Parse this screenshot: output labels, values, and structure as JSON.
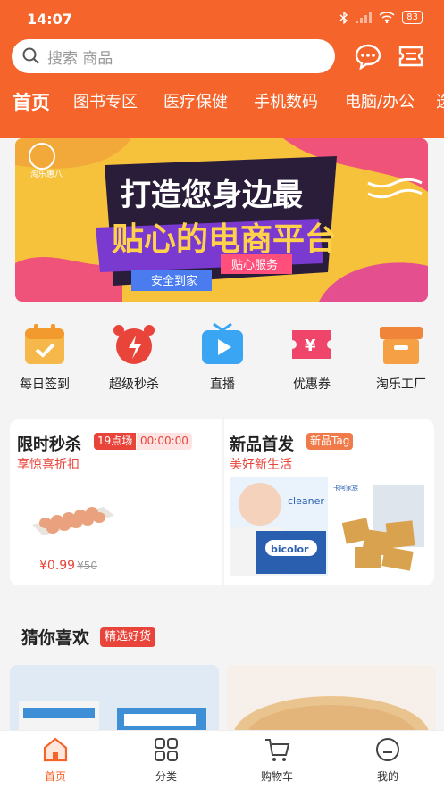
{
  "status": {
    "time": "14:07",
    "battery": "83"
  },
  "search": {
    "placeholder": "搜索 商品"
  },
  "tabs": [
    {
      "label": "首页"
    },
    {
      "label": "图书专区"
    },
    {
      "label": "医疗保健"
    },
    {
      "label": "手机数码"
    },
    {
      "label": "电脑/办公"
    },
    {
      "label": "选"
    }
  ],
  "banner": {
    "logo_text": "淘乐惠八",
    "headline1": "打造您身边最",
    "headline2": "贴心的电商平台",
    "tag1": "安全到家",
    "tag2": "贴心服务"
  },
  "categories": [
    {
      "label": "每日签到",
      "icon": "calendar-check-icon"
    },
    {
      "label": "超级秒杀",
      "icon": "alarm-clock-icon"
    },
    {
      "label": "直播",
      "icon": "tv-play-icon"
    },
    {
      "label": "优惠券",
      "icon": "coupon-icon"
    },
    {
      "label": "淘乐工厂",
      "icon": "box-icon"
    }
  ],
  "flash": {
    "title": "限时秒杀",
    "session": "19点场",
    "countdown": "00:00:00",
    "subtitle": "享惊喜折扣",
    "price": "¥0.99",
    "old_price": "¥50"
  },
  "newarrival": {
    "title": "新品首发",
    "tag": "新品Tag",
    "subtitle": "美好新生活",
    "brand1": "cleaner",
    "brand2": "bicolor",
    "brand3": "卡阿家族"
  },
  "guess": {
    "title": "猜你喜欢",
    "badge": "精选好货"
  },
  "nav": [
    {
      "label": "首页",
      "icon": "home-icon"
    },
    {
      "label": "分类",
      "icon": "category-grid-icon"
    },
    {
      "label": "购物车",
      "icon": "cart-icon"
    },
    {
      "label": "我的",
      "icon": "profile-icon"
    }
  ],
  "colors": {
    "brand": "#f5642b",
    "accent": "#e8443a"
  }
}
